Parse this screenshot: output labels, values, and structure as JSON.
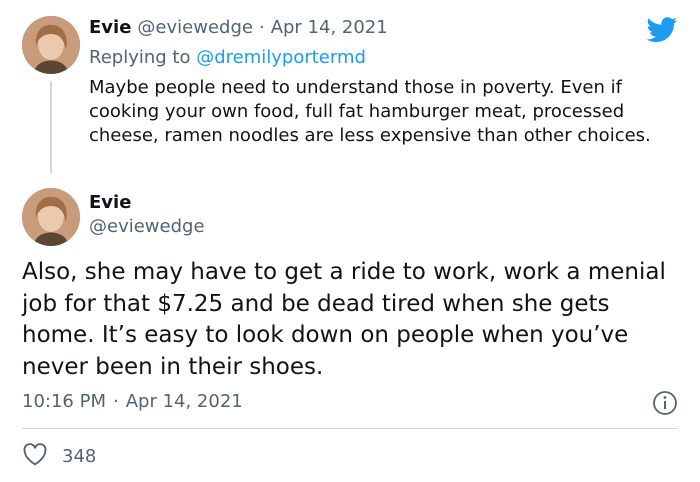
{
  "reply_tweet": {
    "author_name": "Evie",
    "author_handle": "@eviewedge",
    "separator": "·",
    "date": "Apr 14, 2021",
    "replying_label": "Replying to",
    "replying_handle": "@dremilyportermd",
    "text": "Maybe people need to understand those in poverty. Even if cooking your own food, full fat hamburger meat, processed cheese, ramen noodles are less expensive than other choices."
  },
  "main_tweet": {
    "author_name": "Evie",
    "author_handle": "@eviewedge",
    "text": "Also, she may have to get a ride to work, work a menial job for that $7.25 and be dead tired when she gets home. It’s easy to look down on people when you’ve never been in their shoes.",
    "time": "10:16 PM",
    "separator": "·",
    "date": "Apr 14, 2021",
    "likes": "348"
  },
  "icons": {
    "brand": "twitter-bird-icon",
    "info": "info-icon",
    "like": "heart-icon"
  },
  "colors": {
    "brand_blue": "#1d9bf0",
    "muted": "#536471",
    "divider": "#cfd9de"
  }
}
